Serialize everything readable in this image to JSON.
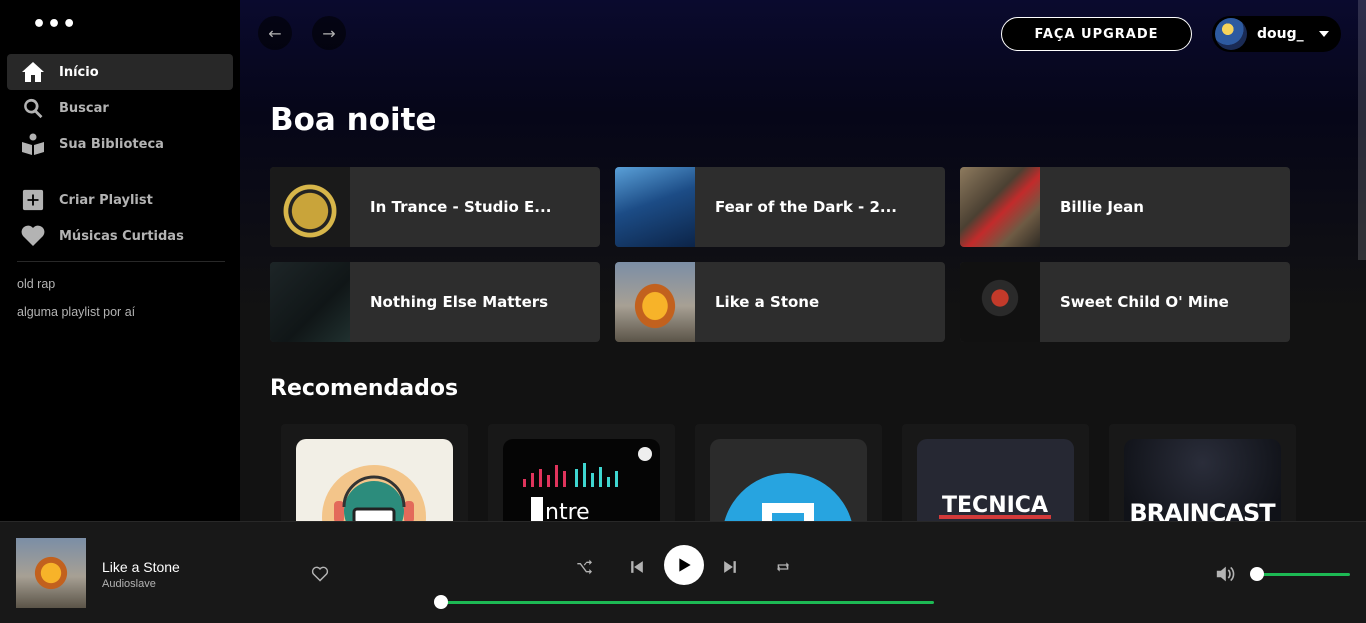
{
  "sidebar": {
    "nav": [
      {
        "label": "Início",
        "icon": "home-icon"
      },
      {
        "label": "Buscar",
        "icon": "search-icon"
      },
      {
        "label": "Sua Biblioteca",
        "icon": "library-icon"
      }
    ],
    "actions": [
      {
        "label": "Criar Playlist",
        "icon": "plus-icon"
      },
      {
        "label": "Músicas Curtidas",
        "icon": "heart-icon"
      }
    ],
    "playlists": [
      "old rap",
      "alguma playlist por aí"
    ]
  },
  "header": {
    "upgrade_label": "FAÇA UPGRADE",
    "username": "doug_"
  },
  "main": {
    "greeting": "Boa noite",
    "shortcuts": [
      {
        "title": "In Trance - Studio E..."
      },
      {
        "title": "Fear of the Dark - 2..."
      },
      {
        "title": "Billie Jean"
      },
      {
        "title": "Nothing Else Matters"
      },
      {
        "title": "Like a Stone"
      },
      {
        "title": "Sweet Child O' Mine"
      }
    ],
    "section_title": "Recomendados",
    "rec_art_text": [
      "",
      "ntre",
      "",
      "TECNICA",
      "BRAINCAST"
    ]
  },
  "player": {
    "track": "Like a Stone",
    "artist": "Audioslave",
    "progress_fraction": 0,
    "volume_fraction": 0
  },
  "colors": {
    "accent": "#1db954",
    "sidebar_bg": "#000000",
    "card_bg": "#2d2d2d",
    "player_bg": "#181818"
  }
}
